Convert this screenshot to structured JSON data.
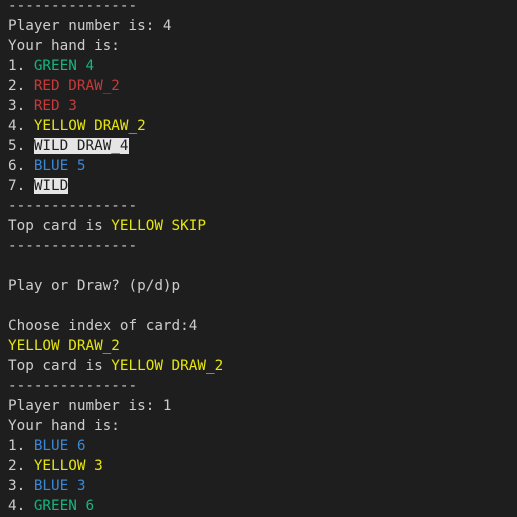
{
  "colors": {
    "background": "#1e1e1e",
    "default_text": "#cccccc",
    "green": "#16b57f",
    "red": "#c63a3a",
    "yellow": "#e5e510",
    "blue": "#3a88d4",
    "wild_background": "#e5e5e5",
    "wild_text": "#1e1e1e"
  },
  "terminal": {
    "lines": [
      {
        "segments": [
          {
            "text": "---------------"
          }
        ]
      },
      {
        "segments": [
          {
            "text": "Player number is: 4"
          }
        ]
      },
      {
        "segments": [
          {
            "text": "Your hand is:"
          }
        ]
      },
      {
        "segments": [
          {
            "text": "1. "
          },
          {
            "text": "GREEN 4",
            "color": "green"
          }
        ]
      },
      {
        "segments": [
          {
            "text": "2. "
          },
          {
            "text": "RED DRAW_2",
            "color": "red"
          }
        ]
      },
      {
        "segments": [
          {
            "text": "3. "
          },
          {
            "text": "RED 3",
            "color": "red"
          }
        ]
      },
      {
        "segments": [
          {
            "text": "4. "
          },
          {
            "text": "YELLOW DRAW_2",
            "color": "yellow"
          }
        ]
      },
      {
        "segments": [
          {
            "text": "5. "
          },
          {
            "text": "WILD DRAW_4",
            "color": "wild"
          }
        ]
      },
      {
        "segments": [
          {
            "text": "6. "
          },
          {
            "text": "BLUE 5",
            "color": "blue"
          }
        ]
      },
      {
        "segments": [
          {
            "text": "7. "
          },
          {
            "text": "WILD",
            "color": "wild"
          }
        ]
      },
      {
        "segments": [
          {
            "text": "---------------"
          }
        ]
      },
      {
        "segments": [
          {
            "text": "Top card is "
          },
          {
            "text": "YELLOW SKIP",
            "color": "yellow"
          }
        ]
      },
      {
        "segments": [
          {
            "text": "---------------"
          }
        ]
      },
      {
        "segments": []
      },
      {
        "segments": [
          {
            "text": "Play or Draw? (p/d)p"
          }
        ]
      },
      {
        "segments": []
      },
      {
        "segments": [
          {
            "text": "Choose index of card:4"
          }
        ]
      },
      {
        "segments": [
          {
            "text": "YELLOW DRAW_2",
            "color": "yellow"
          }
        ]
      },
      {
        "segments": [
          {
            "text": "Top card is "
          },
          {
            "text": "YELLOW DRAW_2",
            "color": "yellow"
          }
        ]
      },
      {
        "segments": [
          {
            "text": "---------------"
          }
        ]
      },
      {
        "segments": [
          {
            "text": "Player number is: 1"
          }
        ]
      },
      {
        "segments": [
          {
            "text": "Your hand is:"
          }
        ]
      },
      {
        "segments": [
          {
            "text": "1. "
          },
          {
            "text": "BLUE 6",
            "color": "blue"
          }
        ]
      },
      {
        "segments": [
          {
            "text": "2. "
          },
          {
            "text": "YELLOW 3",
            "color": "yellow"
          }
        ]
      },
      {
        "segments": [
          {
            "text": "3. "
          },
          {
            "text": "BLUE 3",
            "color": "blue"
          }
        ]
      },
      {
        "segments": [
          {
            "text": "4. "
          },
          {
            "text": "GREEN 6",
            "color": "green"
          }
        ]
      }
    ]
  }
}
